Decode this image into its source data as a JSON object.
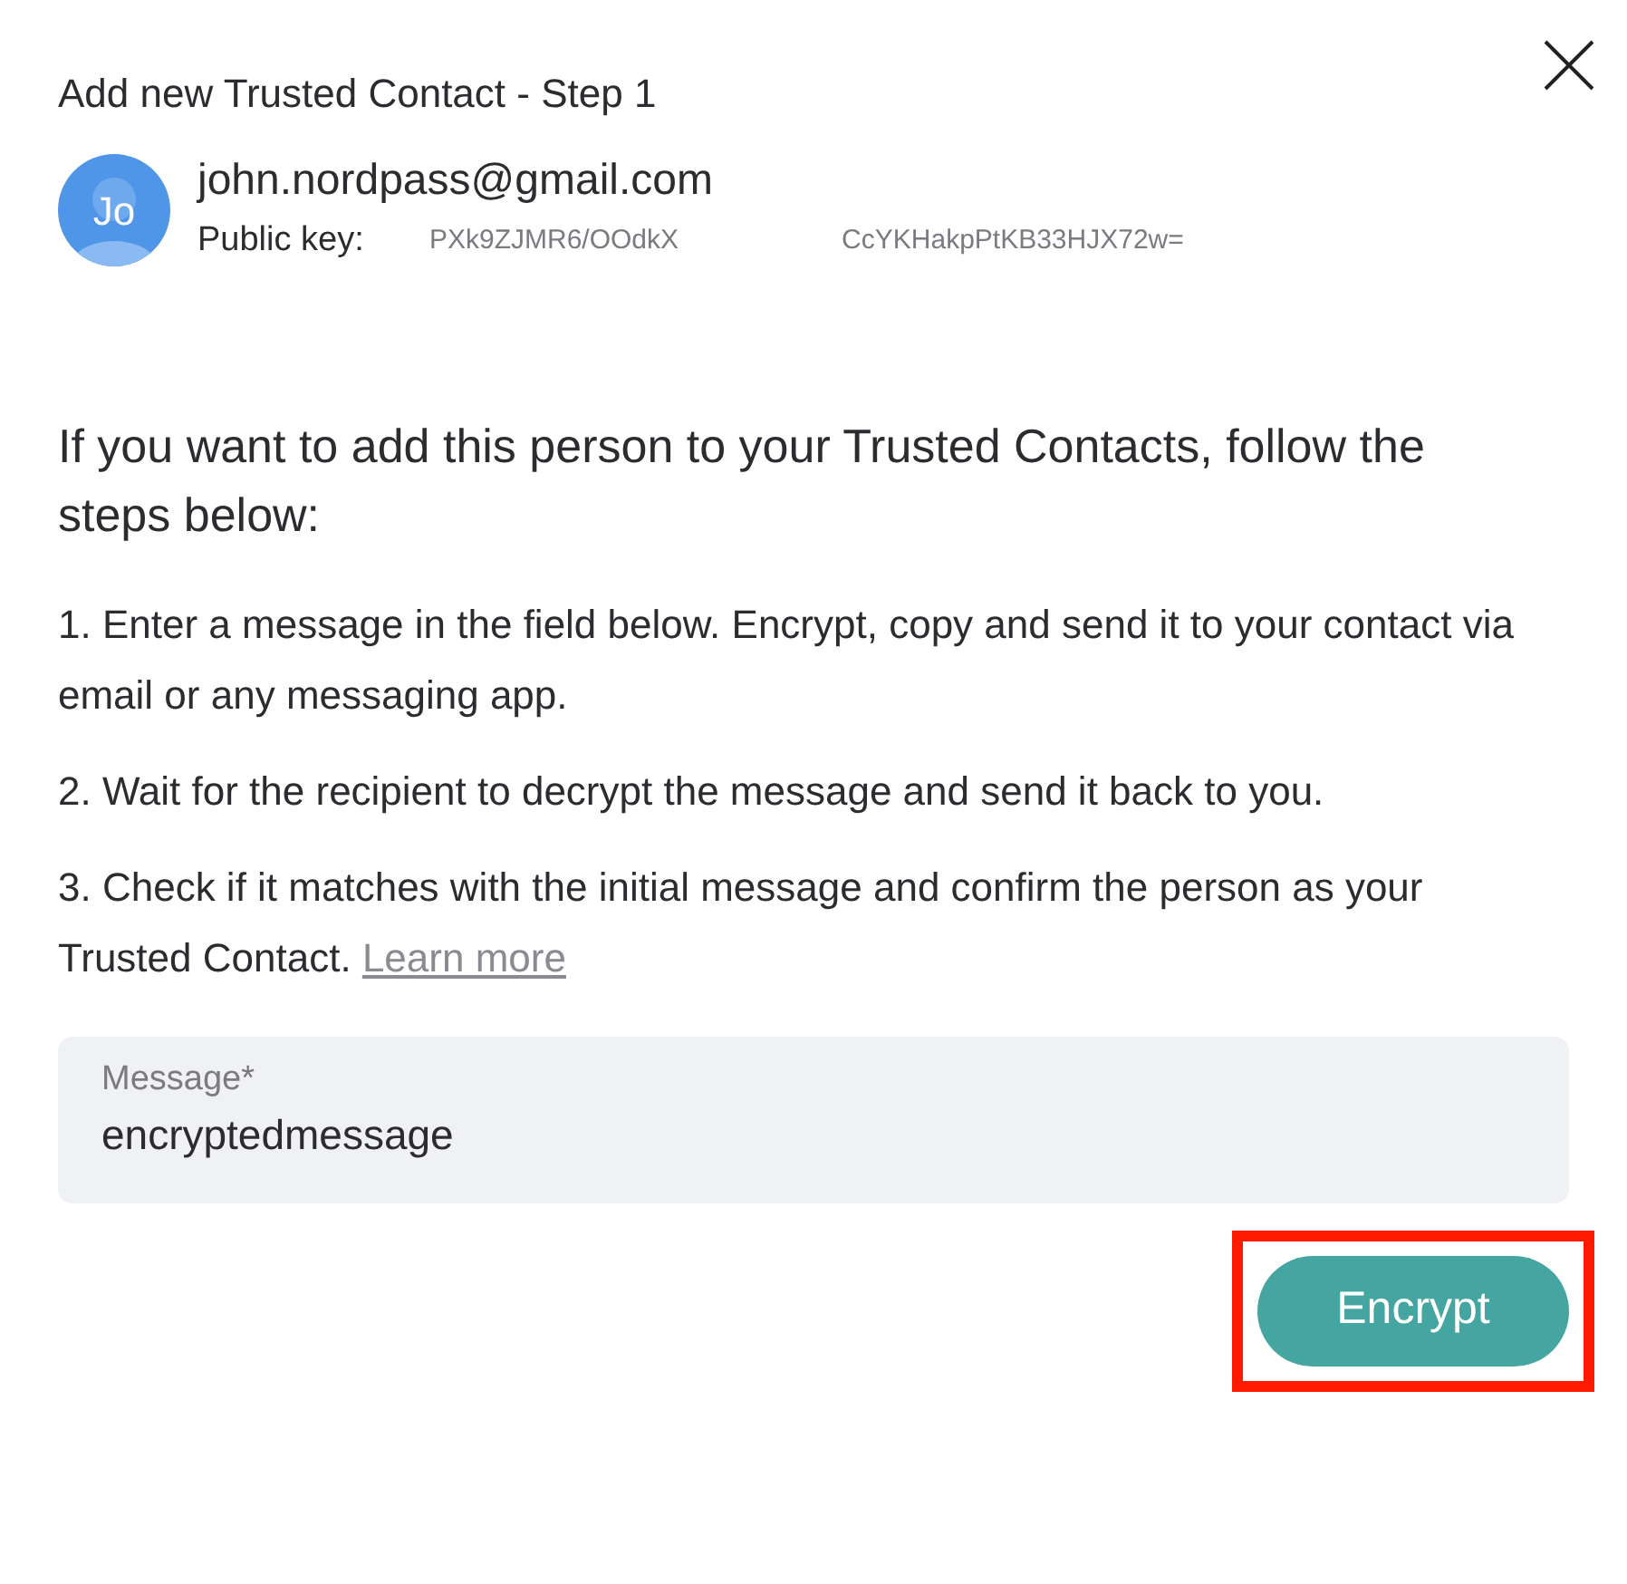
{
  "dialog": {
    "title": "Add new Trusted Contact - Step 1"
  },
  "contact": {
    "avatar_initials": "Jo",
    "email": "john.nordpass@gmail.com",
    "public_key_label": "Public key:",
    "public_key_parts": [
      "PXk9ZJMR6/OOdkX",
      "CcYKHakpPtKB33HJX72w="
    ]
  },
  "intro": "If you want to add this person to your Trusted Contacts, follow the steps below:",
  "steps": [
    {
      "text": "1. Enter a message in the field below. Encrypt, copy and send it to your contact via email or any messaging app."
    },
    {
      "text": "2. Wait for the recipient to decrypt the message and send it back to you."
    },
    {
      "text": "3. Check if it matches with the initial message and confirm the person as your Trusted Contact.",
      "link": "Learn more"
    }
  ],
  "message_field": {
    "label": "Message*",
    "value": "encryptedmessage"
  },
  "encrypt_button": {
    "label": "Encrypt",
    "highlighted": true
  }
}
